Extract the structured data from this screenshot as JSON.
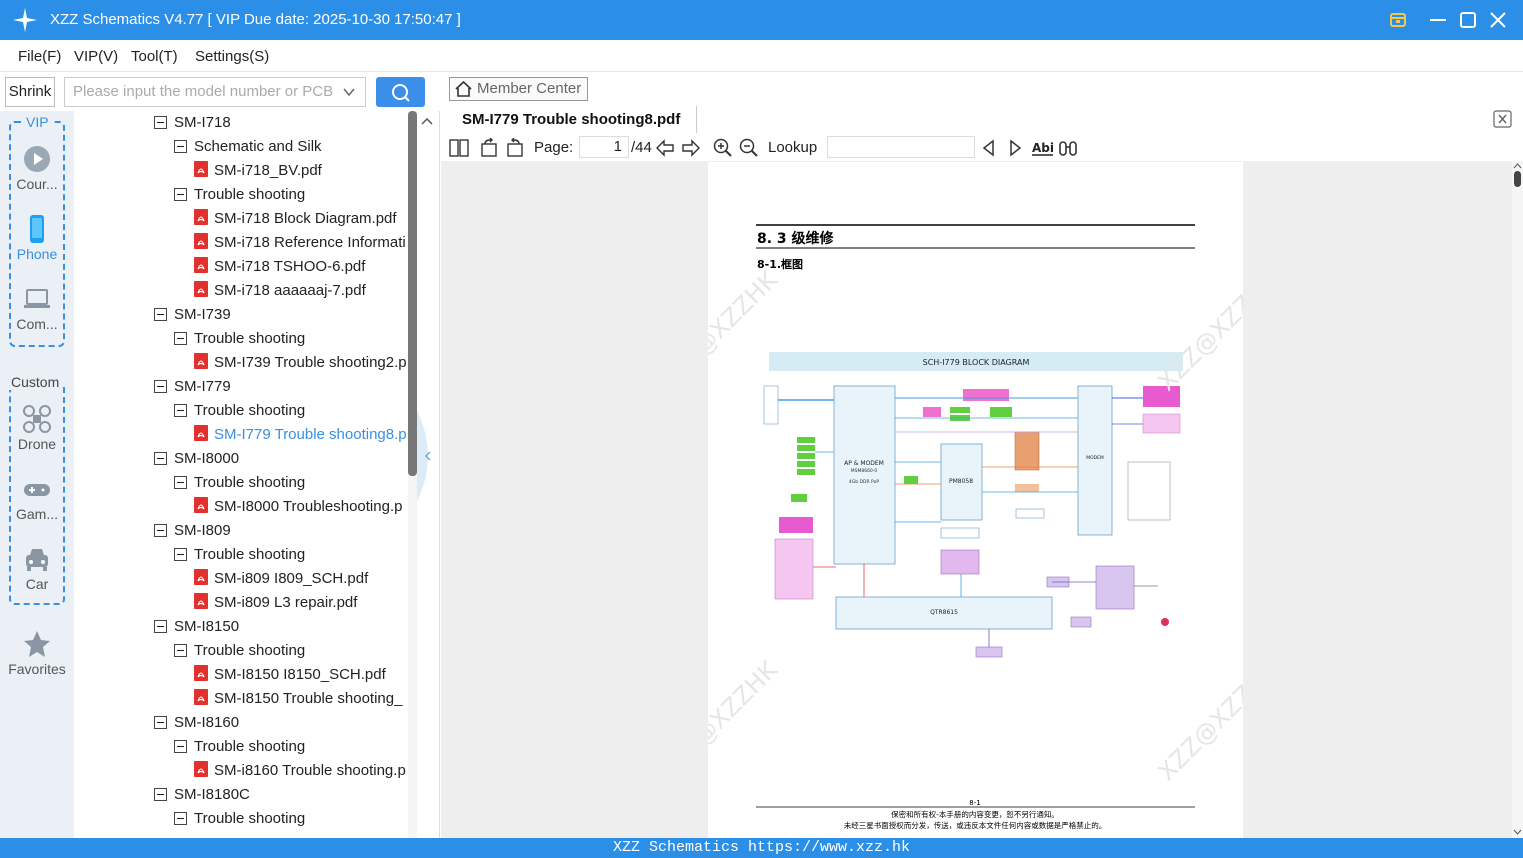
{
  "app": {
    "title": "XZZ Schematics V4.77 [ VIP Due date: 2025-10-30 17:50:47 ]"
  },
  "menu": [
    "File(F)",
    "VIP(V)",
    "Tool(T)",
    "Settings(S)"
  ],
  "toolbar_left": {
    "shrink_label": "Shrink",
    "search_placeholder": "Please input the model number or PCB"
  },
  "sidenav": {
    "vip_label": "VIP",
    "custom_label": "Custom",
    "items": [
      {
        "label": "Cour...",
        "icon": "play-icon"
      },
      {
        "label": "Phone",
        "icon": "phone-icon"
      },
      {
        "label": "Com...",
        "icon": "laptop-icon"
      },
      {
        "label": "Drone",
        "icon": "drone-icon"
      },
      {
        "label": "Gam...",
        "icon": "gamepad-icon"
      },
      {
        "label": "Car",
        "icon": "car-icon"
      },
      {
        "label": "Favorites",
        "icon": "star-icon"
      }
    ]
  },
  "tree": [
    {
      "level": 0,
      "kind": "folder",
      "label": "SM-I718"
    },
    {
      "level": 1,
      "kind": "folder",
      "label": "Schematic and Silk"
    },
    {
      "level": 2,
      "kind": "pdf",
      "label": "SM-i718_BV.pdf"
    },
    {
      "level": 1,
      "kind": "folder",
      "label": "Trouble shooting"
    },
    {
      "level": 2,
      "kind": "pdf",
      "label": "SM-i718 Block Diagram.pdf"
    },
    {
      "level": 2,
      "kind": "pdf",
      "label": "SM-i718 Reference Informati"
    },
    {
      "level": 2,
      "kind": "pdf",
      "label": "SM-i718 TSHOO-6.pdf"
    },
    {
      "level": 2,
      "kind": "pdf",
      "label": "SM-i718 aaaaaaj-7.pdf"
    },
    {
      "level": 0,
      "kind": "folder",
      "label": "SM-I739"
    },
    {
      "level": 1,
      "kind": "folder",
      "label": "Trouble shooting"
    },
    {
      "level": 2,
      "kind": "pdf",
      "label": "SM-I739 Trouble shooting2.p"
    },
    {
      "level": 0,
      "kind": "folder",
      "label": "SM-I779"
    },
    {
      "level": 1,
      "kind": "folder",
      "label": "Trouble shooting"
    },
    {
      "level": 2,
      "kind": "pdf",
      "label": "SM-I779 Trouble shooting8.p",
      "selected": true
    },
    {
      "level": 0,
      "kind": "folder",
      "label": "SM-I8000"
    },
    {
      "level": 1,
      "kind": "folder",
      "label": "Trouble shooting"
    },
    {
      "level": 2,
      "kind": "pdf",
      "label": "SM-I8000 Troubleshooting.p"
    },
    {
      "level": 0,
      "kind": "folder",
      "label": "SM-I809"
    },
    {
      "level": 1,
      "kind": "folder",
      "label": "Trouble shooting"
    },
    {
      "level": 2,
      "kind": "pdf",
      "label": "SM-i809 I809_SCH.pdf"
    },
    {
      "level": 2,
      "kind": "pdf",
      "label": "SM-i809 L3 repair.pdf"
    },
    {
      "level": 0,
      "kind": "folder",
      "label": "SM-I8150"
    },
    {
      "level": 1,
      "kind": "folder",
      "label": "Trouble shooting"
    },
    {
      "level": 2,
      "kind": "pdf",
      "label": "SM-I8150 I8150_SCH.pdf"
    },
    {
      "level": 2,
      "kind": "pdf",
      "label": "SM-I8150 Trouble shooting_"
    },
    {
      "level": 0,
      "kind": "folder",
      "label": "SM-I8160"
    },
    {
      "level": 1,
      "kind": "folder",
      "label": "Trouble shooting"
    },
    {
      "level": 2,
      "kind": "pdf",
      "label": "SM-i8160 Trouble shooting.p"
    },
    {
      "level": 0,
      "kind": "folder",
      "label": "SM-I8180C"
    },
    {
      "level": 1,
      "kind": "folder",
      "label": "Trouble shooting"
    }
  ],
  "viewer": {
    "member_center": "Member Center",
    "document_tab": "SM-I779 Trouble shooting8.pdf",
    "page_label": "Page:",
    "page_current": "1",
    "page_total": "/44",
    "lookup_label": "Lookup"
  },
  "pdf": {
    "heading": "8. 3 级维修",
    "subheading": "8-1.框图",
    "diagram_title": "SCH-I779 BLOCK DIAGRAM",
    "blocks": {
      "ap_modem": "AP & MODEM",
      "ap_part": "MSM8660-0",
      "ap_mem": "4Gb DDR PoP",
      "pmic": "PM8058",
      "modem": "MODEM",
      "rf": "QTR8615"
    },
    "page_number": "8-1",
    "footer_line1": "保密和所有权-本手册的内容变更，恕不另行通知。",
    "footer_line2": "未经三星书面授权而分发，传送，或违反本文件任何内容或数据是严格禁止的。",
    "watermark": "XZZ@XZZHK"
  },
  "status": {
    "text": "XZZ Schematics https://www.xzz.hk"
  },
  "colors": {
    "accent": "#2b8fe8",
    "selected": "#3a8fe0",
    "pdf_icon": "#e0312f"
  }
}
